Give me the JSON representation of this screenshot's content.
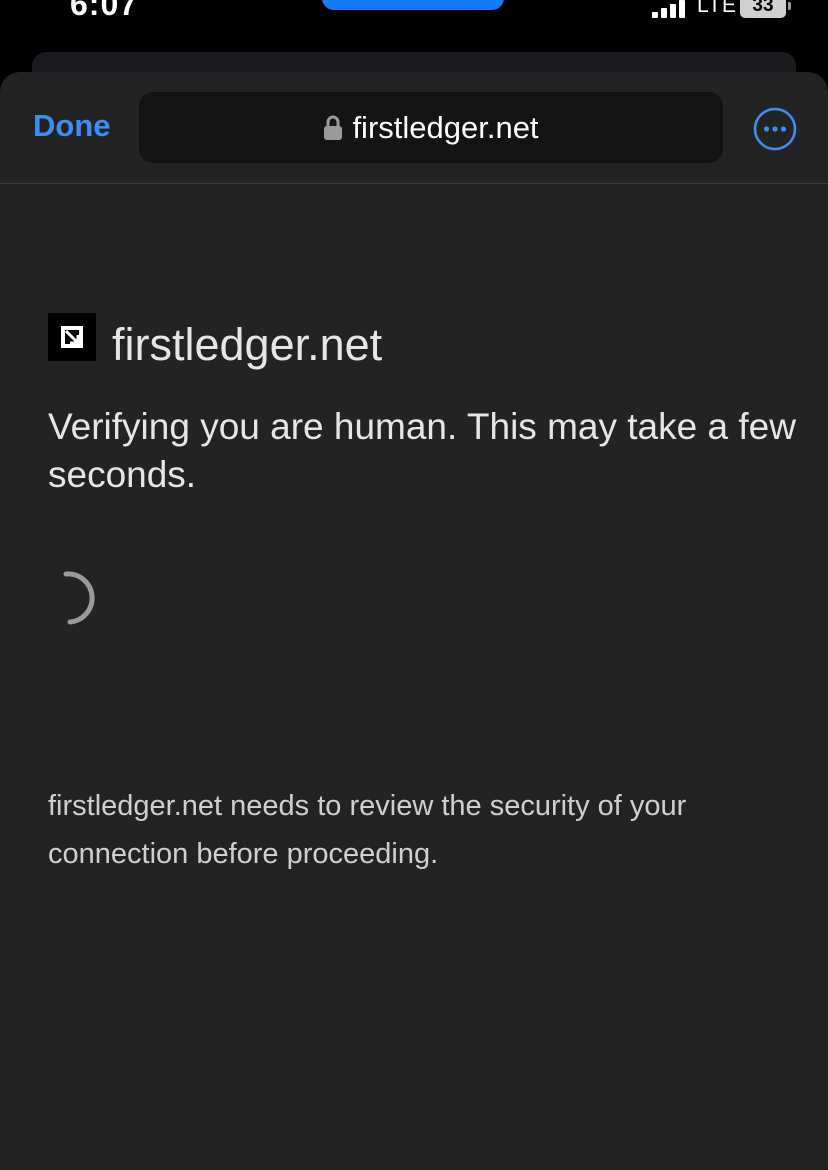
{
  "status_bar": {
    "time": "6:07",
    "network": "LTE",
    "battery": "33",
    "signal_icon": "cellular-signal-icon",
    "battery_icon": "battery-icon"
  },
  "toolbar": {
    "done_label": "Done",
    "address": "firstledger.net",
    "lock_icon": "lock-icon",
    "more_icon": "ellipsis-circle-icon",
    "accent_color": "#3c8ef3"
  },
  "page": {
    "site_name": "firstledger.net",
    "headline": "Verifying you are human. This may take a few seconds.",
    "notice": "firstledger.net needs to review the security of your connection before proceeding.",
    "logo_icon": "site-logo-icon",
    "spinner_icon": "loading-spinner-icon"
  },
  "colors": {
    "sheet_background": "#232323",
    "address_background": "#141414",
    "dynamic_island_pill": "#1479f5"
  }
}
